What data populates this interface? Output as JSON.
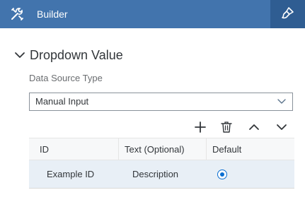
{
  "header": {
    "title": "Builder",
    "tools_icon": "tools-icon",
    "brush_icon": "paint-brush-icon",
    "background": "#4274ad"
  },
  "section": {
    "title": "Dropdown Value",
    "collapse_icon": "chevron-down-icon"
  },
  "data_source": {
    "label": "Data Source Type",
    "value": "Manual Input",
    "arrow_icon": "chevron-down-icon"
  },
  "toolbar": {
    "add_icon": "add-icon",
    "delete_icon": "delete-icon",
    "move_up_icon": "chevron-up-icon",
    "move_down_icon": "chevron-down-icon"
  },
  "table": {
    "columns": [
      "ID",
      "Text (Optional)",
      "Default"
    ],
    "rows": [
      {
        "id": "Example ID",
        "text": "Description",
        "default": true
      }
    ],
    "selected_row_color": "#e8eff6",
    "accent": "#0a6ed1"
  }
}
